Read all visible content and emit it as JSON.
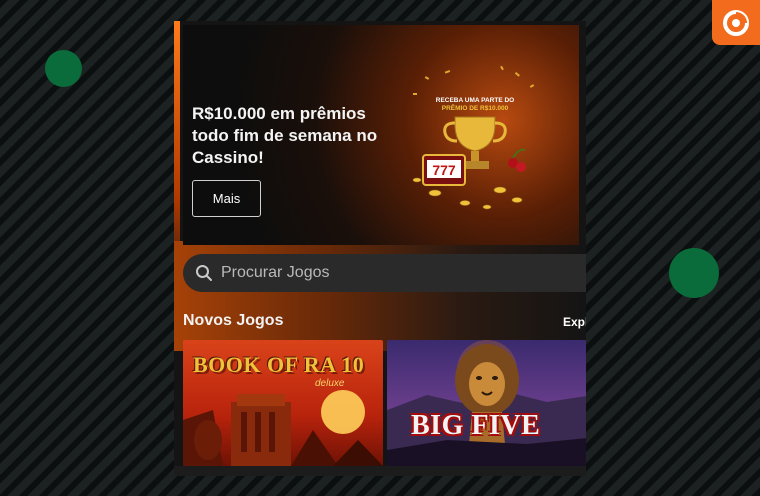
{
  "banner": {
    "title": "R$10.000 em prêmios todo fim de semana no Cassino!",
    "button_label": "Mais",
    "art_text_line1": "RECEBA UMA PARTE DO",
    "art_text_line2": "PRÊMIO DE R$10.000",
    "slot_digits": "777"
  },
  "search": {
    "placeholder": "Procurar Jogos"
  },
  "section": {
    "title": "Novos Jogos",
    "link_label": "Expl"
  },
  "games": [
    {
      "title": "BOOK OF RA 10",
      "subtitle": "deluxe"
    },
    {
      "title": "BIG FIVE"
    }
  ],
  "colors": {
    "brand_orange": "#f36b1c",
    "green_dot": "#0a6b3b"
  }
}
